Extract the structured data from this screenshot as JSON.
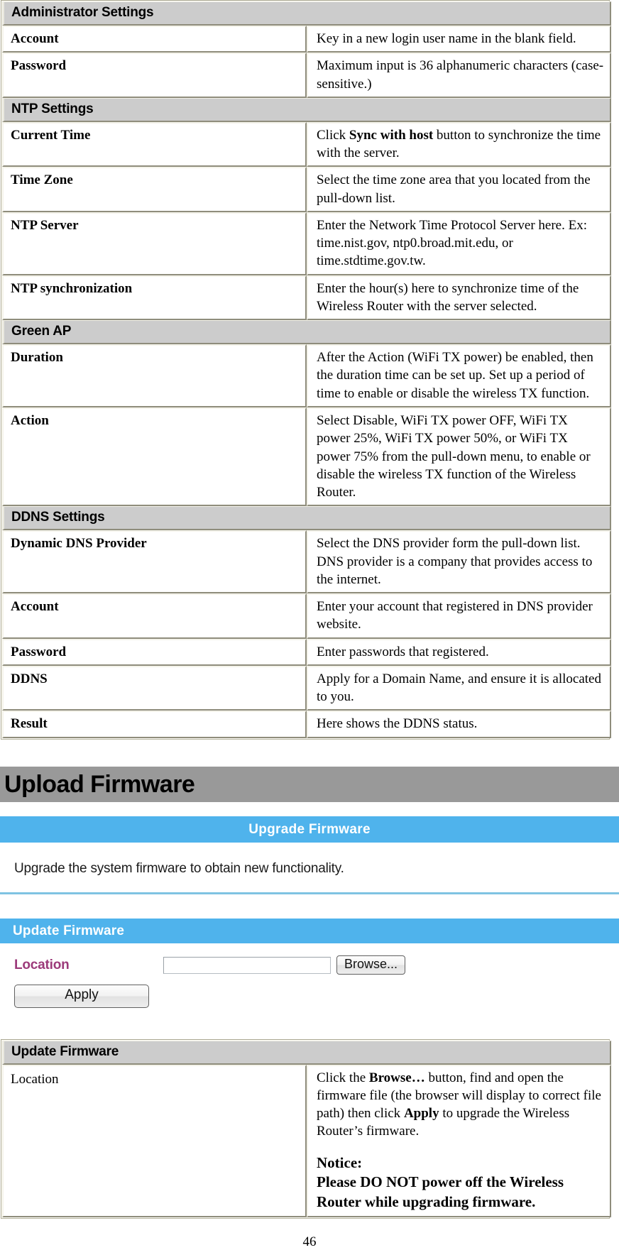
{
  "settings_table": {
    "rows": [
      {
        "kind": "section",
        "label": "Administrator Settings"
      },
      {
        "kind": "data",
        "label": "Account",
        "desc": "Key in a new login user name in the blank field."
      },
      {
        "kind": "data",
        "label": "Password",
        "desc": "Maximum input is 36 alphanumeric characters (case-sensitive.)"
      },
      {
        "kind": "section",
        "label": "NTP Settings"
      },
      {
        "kind": "data",
        "label": "Current Time",
        "desc_pre": "Click ",
        "desc_bold": "Sync with host",
        "desc_post": " button to synchronize the time with the server."
      },
      {
        "kind": "data",
        "label": "Time Zone",
        "desc": "Select the time zone area that you located from the pull-down list."
      },
      {
        "kind": "data",
        "label": "NTP Server",
        "desc": "Enter the Network Time Protocol Server here. Ex: time.nist.gov, ntp0.broad.mit.edu, or time.stdtime.gov.tw."
      },
      {
        "kind": "data",
        "label": "NTP synchronization",
        "desc": "Enter the hour(s) here to synchronize time of the Wireless  Router with the server selected."
      },
      {
        "kind": "section",
        "label": "Green AP"
      },
      {
        "kind": "data",
        "label": "Duration",
        "desc": "After the Action (WiFi TX power) be enabled, then the duration time can be set up. Set up a period of time to enable or disable the wireless TX function."
      },
      {
        "kind": "data",
        "label": "Action",
        "desc": "Select Disable, WiFi TX power OFF, WiFi TX power 25%, WiFi TX power 50%, or WiFi TX power 75% from the pull-down menu, to enable or disable the wireless TX function of the Wireless  Router."
      },
      {
        "kind": "section",
        "label": "DDNS Settings"
      },
      {
        "kind": "data",
        "label": "Dynamic DNS Provider",
        "desc": "Select the DNS provider form the pull-down list. DNS provider is a company that provides access to the internet."
      },
      {
        "kind": "data",
        "label": "Account",
        "desc": "Enter your account that registered in DNS provider website."
      },
      {
        "kind": "data",
        "label": "Password",
        "desc": "Enter passwords that registered."
      },
      {
        "kind": "data",
        "label": "DDNS",
        "desc": "Apply for a Domain Name, and ensure it is allocated to you."
      },
      {
        "kind": "data",
        "label": "Result",
        "desc": "Here shows the DDNS status."
      }
    ]
  },
  "heading": {
    "title": "Upload Firmware"
  },
  "screenshot": {
    "banner_title": "Upgrade Firmware",
    "intro_text": "Upgrade the system firmware to obtain new functionality.",
    "panel_title": "Update Firmware",
    "location_label": "Location",
    "location_value": "",
    "location_placeholder": "",
    "browse_button": "Browse...",
    "apply_button": "Apply",
    "colors": {
      "banner_blue": "#4fb3ec",
      "rule_blue": "#7fc3e2",
      "label_purple": "#9c3a7a"
    }
  },
  "firmware_table": {
    "section_label": "Update Firmware",
    "row_label": "Location",
    "desc_pre": "Click the ",
    "desc_bold1": "Browse…",
    "desc_mid": " button, find and open the firmware file (the browser will display to correct file path) then click ",
    "desc_bold2": "Apply",
    "desc_post": " to upgrade the Wireless Router’s firmware.",
    "notice_title": "Notice:",
    "notice_body": "Please DO NOT power off the Wireless  Router while upgrading firmware."
  },
  "footer": {
    "page_number": "46"
  }
}
